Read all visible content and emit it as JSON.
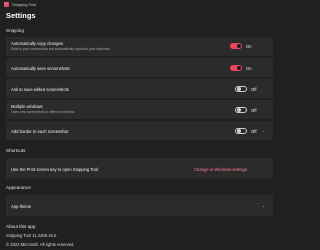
{
  "window": {
    "title": "Snipping Tool"
  },
  "page": {
    "title": "Settings"
  },
  "sections": {
    "snipping": "Snipping",
    "shortcuts": "Shortcuts",
    "appearance": "Appearance",
    "about": "About this app"
  },
  "snipping_settings": [
    {
      "title": "Automatically copy changes",
      "subtitle": "Edits to your screenshots are automatically copied to your clipboard",
      "state": "On",
      "on": true
    },
    {
      "title": "Automatically save screenshots",
      "subtitle": "",
      "state": "On",
      "on": true
    },
    {
      "title": "Ask to save edited screenshots",
      "subtitle": "",
      "state": "Off",
      "on": false
    },
    {
      "title": "Multiple windows",
      "subtitle": "Open new screenshots in different windows",
      "state": "Off",
      "on": false
    },
    {
      "title": "Add border to each screenshot",
      "subtitle": "",
      "state": "Off",
      "on": false
    }
  ],
  "shortcuts": {
    "text": "Use the Print screen key to open Snipping Tool",
    "link": "Change in Windows settings"
  },
  "appearance": {
    "label": "App theme"
  },
  "about": {
    "version": "Snipping Tool 11.2309.16.0",
    "copyright": "© 2023 Microsoft. All rights reserved."
  },
  "colors": {
    "background": "#202020",
    "card": "#2b2b2b",
    "accent": "#e8465f",
    "link": "#ff8196"
  }
}
